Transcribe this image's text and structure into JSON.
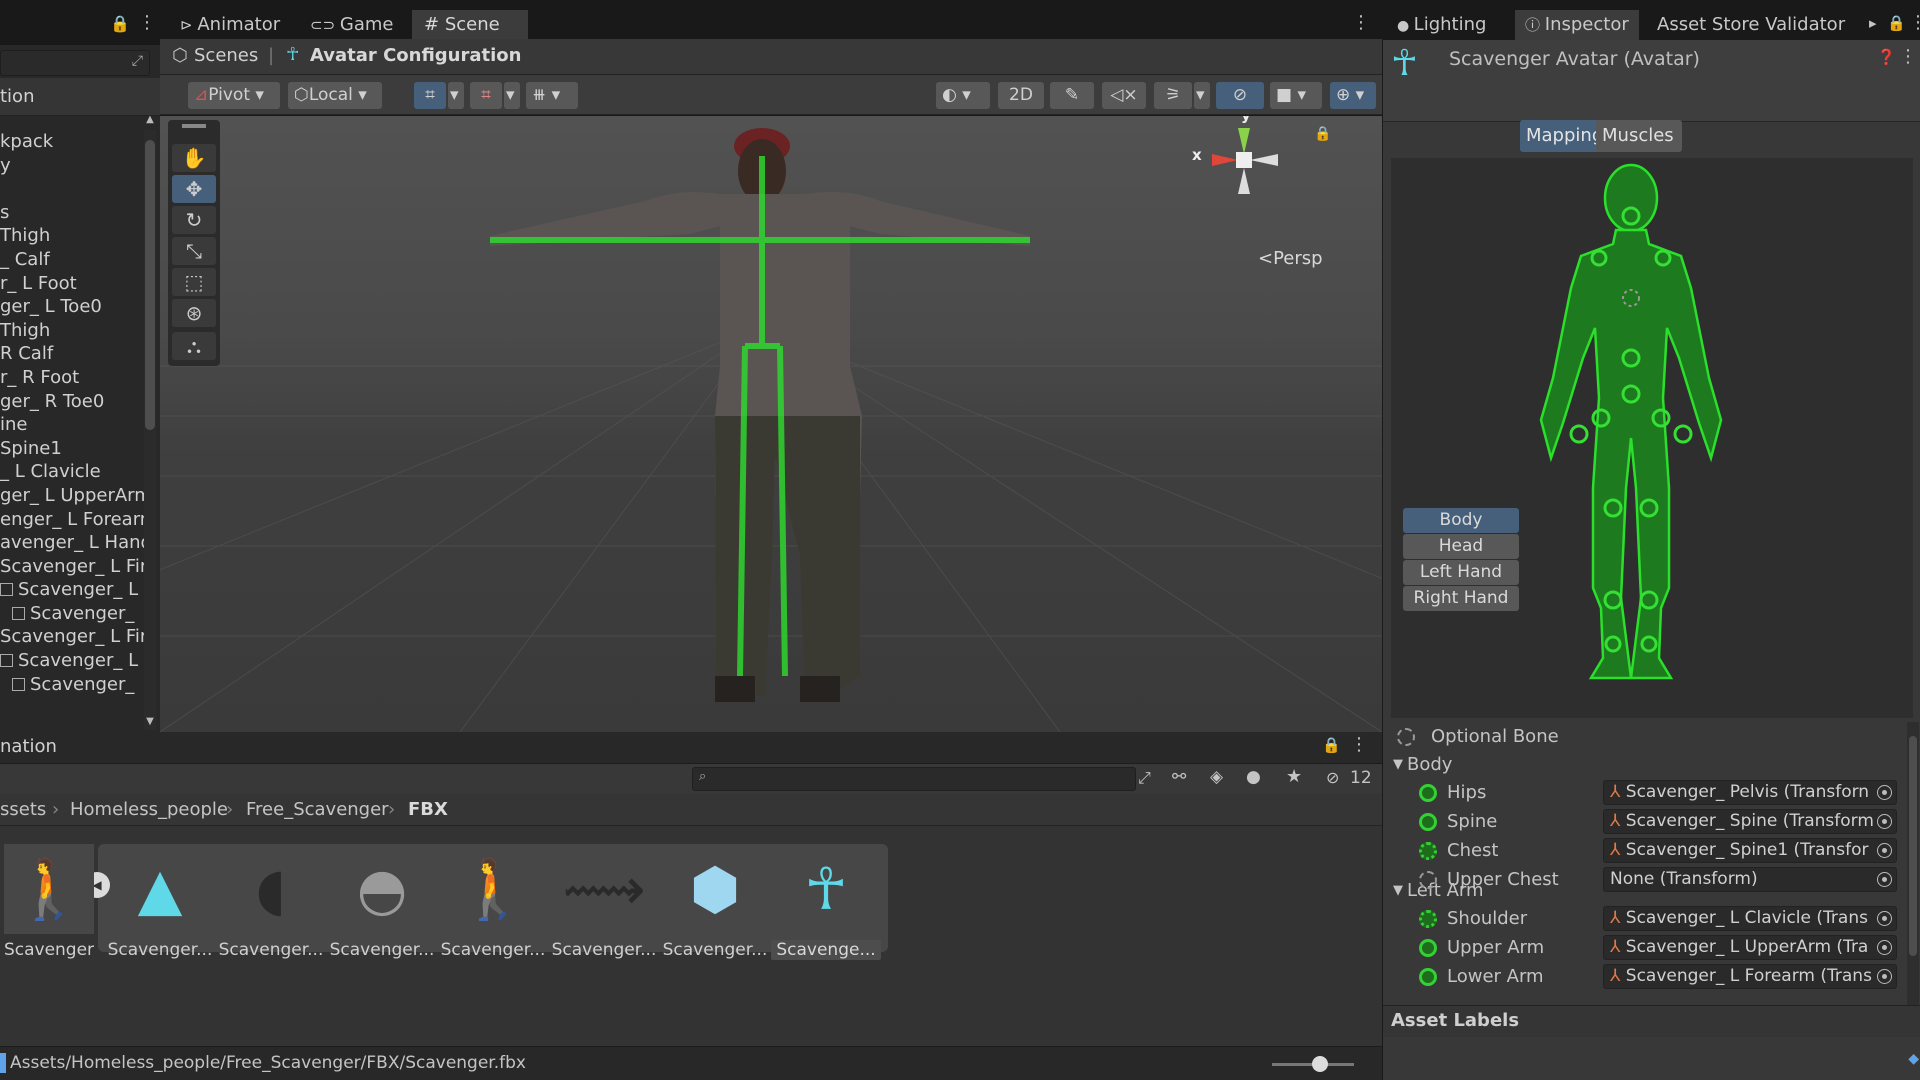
{
  "hierarchy": {
    "header": "tion",
    "items": [
      "kpack",
      "y",
      "",
      "s",
      "Thigh",
      "_ Calf",
      "r_ L Foot",
      "ger_ L Toe0",
      "Thigh",
      "R Calf",
      "r_ R Foot",
      "ger_ R Toe0",
      "ine",
      "Spine1",
      "_ L Clavicle",
      "ger_ L UpperArm",
      "enger_ L Forearm",
      "avenger_ L Hand",
      "Scavenger_ L Fir",
      "Scavenger_ L I",
      "Scavenger_",
      "Scavenger_ L Fir",
      "Scavenger_ L I",
      "Scavenger_"
    ]
  },
  "tabs": {
    "animator": "Animator",
    "game": "Game",
    "scene": "Scene"
  },
  "breadcrumb": {
    "scenes": "Scenes",
    "separator": "|",
    "avatar_config": "Avatar Configuration"
  },
  "scene_toolbar": {
    "pivot": "Pivot",
    "local": "Local",
    "mode2d": "2D"
  },
  "gizmo": {
    "y": "y",
    "x": "x",
    "persp": "Persp"
  },
  "project": {
    "header": "nation",
    "hidden_count": "12",
    "path": [
      "ssets",
      "Homeless_people",
      "Free_Scavenger",
      "FBX"
    ],
    "assets": [
      {
        "label": "Scavenger",
        "icon": "character-thumbnail"
      },
      {
        "label": "Scavenger...",
        "icon": "animation-clip-icon"
      },
      {
        "label": "Scavenger...",
        "icon": "backpack-mesh-thumbnail"
      },
      {
        "label": "Scavenger...",
        "icon": "cap-mesh-thumbnail"
      },
      {
        "label": "Scavenger...",
        "icon": "body-mesh-thumbnail"
      },
      {
        "label": "Scavenger...",
        "icon": "rig-mesh-thumbnail"
      },
      {
        "label": "Scavenger...",
        "icon": "prefab-cube-icon"
      },
      {
        "label": "Scavenge...",
        "icon": "avatar-icon"
      }
    ],
    "status_path": "Assets/Homeless_people/Free_Scavenger/FBX/Scavenger.fbx"
  },
  "inspector": {
    "tabs": {
      "lighting": "Lighting",
      "inspector": "Inspector",
      "validator": "Asset Store Validator"
    },
    "title": "Scavenger Avatar (Avatar)",
    "mapping_tab": "Mapping",
    "muscles_tab": "Muscles & Settings",
    "part_buttons": [
      "Body",
      "Head",
      "Left Hand",
      "Right Hand"
    ],
    "optional_bone": "Optional Bone",
    "sections": {
      "body": "Body",
      "left_arm": "Left Arm"
    },
    "bones": [
      {
        "name": "Hips",
        "value": "Scavenger_ Pelvis (Transforn",
        "optional": false
      },
      {
        "name": "Spine",
        "value": "Scavenger_ Spine (Transform",
        "optional": false
      },
      {
        "name": "Chest",
        "value": "Scavenger_ Spine1 (Transfor",
        "optional": true
      },
      {
        "name": "Upper Chest",
        "value": "None (Transform)",
        "optional": true
      },
      {
        "name": "Shoulder",
        "value": "Scavenger_ L Clavicle (Trans",
        "optional": true
      },
      {
        "name": "Upper Arm",
        "value": "Scavenger_ L UpperArm (Tra",
        "optional": false
      },
      {
        "name": "Lower Arm",
        "value": "Scavenger_ L Forearm (Trans",
        "optional": false
      }
    ],
    "asset_labels": "Asset Labels"
  },
  "colors": {
    "accent": "#46607c",
    "bone_green": "#33d133",
    "avatar_cyan": "#5fd9e8",
    "gizmo_red": "#e0463a",
    "gizmo_green": "#8ad24a"
  }
}
